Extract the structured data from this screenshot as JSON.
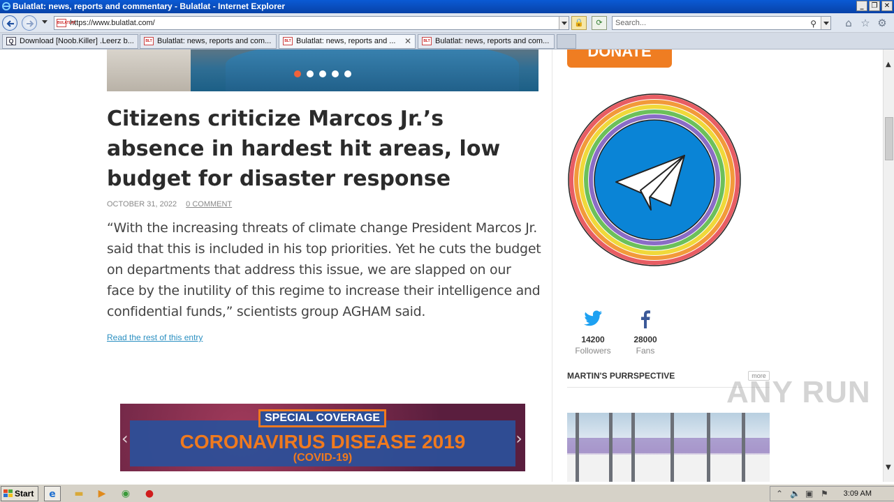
{
  "window": {
    "title": "Bulatlat: news, reports and commentary - Bulatlat - Internet Explorer",
    "controls": [
      "_",
      "❐",
      "✕"
    ]
  },
  "nav": {
    "address": "https://www.bulatlat.com/",
    "search_placeholder": "Search...",
    "favicon_text": "BULATLAT"
  },
  "tabs": [
    {
      "label": "Download [Noob.Killer] .Leerz b...",
      "active": false,
      "icon": "search-icon"
    },
    {
      "label": "Bulatlat: news, reports and com...",
      "active": false,
      "icon": "bulatlat-favicon"
    },
    {
      "label": "Bulatlat: news, reports and ...",
      "active": true,
      "icon": "bulatlat-favicon"
    },
    {
      "label": "Bulatlat: news, reports and com...",
      "active": false,
      "icon": "bulatlat-favicon"
    }
  ],
  "article": {
    "headline": "Citizens criticize Marcos Jr.’s absence in hardest hit areas, low budget for disaster response",
    "date": "OCTOBER 31, 2022",
    "comments": "0 COMMENT",
    "excerpt": "“With the increasing threats of climate change President Marcos Jr. said that this is included in his top priorities. Yet he cuts the budget on departments that address this issue, we are slapped on our face by the inutility of this regime to increase their intelligence and confidential funds,” scientists group AGHAM said.",
    "read_more": "Read the rest of this entry",
    "slider_dots": 5,
    "active_dot": 0
  },
  "banner": {
    "tag": "SPECIAL COVERAGE",
    "title": "CORONAVIRUS DISEASE 2019",
    "subtitle": "(COVID-19)"
  },
  "sidebar": {
    "donate": "DONATE",
    "social": [
      {
        "icon": "twitter-icon",
        "count": "14200",
        "label": "Followers",
        "color": "#1da1f2"
      },
      {
        "icon": "facebook-icon",
        "count": "28000",
        "label": "Fans",
        "color": "#3b5998"
      }
    ],
    "section_title": "MARTIN'S PURRSPECTIVE",
    "more": "more"
  },
  "watermark": "ANY RUN",
  "taskbar": {
    "start": "Start",
    "clock": "3:09 AM"
  },
  "colors": {
    "accent_orange": "#ef7d22",
    "link_blue": "#2a8fc1",
    "telegram_blue": "#2b7fd0"
  }
}
